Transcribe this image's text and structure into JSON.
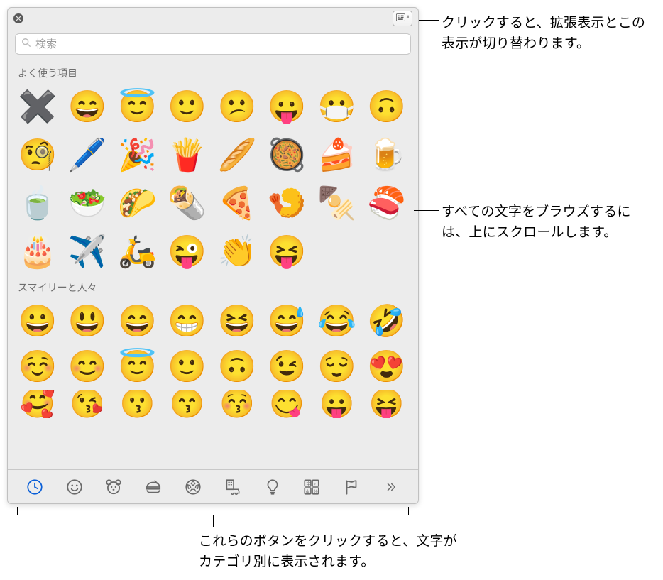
{
  "search": {
    "placeholder": "検索"
  },
  "sections": {
    "frequent": {
      "title": "よく使う項目"
    },
    "smileys": {
      "title": "スマイリーと人々"
    }
  },
  "emojis": {
    "frequent": [
      "✖️",
      "😄",
      "😇",
      "🙂",
      "😕",
      "😛",
      "😷",
      "🙃",
      "🧐",
      "🖊️",
      "🎉",
      "🍟",
      "🥖",
      "🥘",
      "🍰",
      "🍺",
      "🍵",
      "🥗",
      "🌮",
      "🌯",
      "🍕",
      "🍤",
      "🍢",
      "🍣",
      "🎂",
      "✈️",
      "🛵",
      "😜",
      "👏",
      "😝"
    ],
    "smileys_row1": [
      "😀",
      "😃",
      "😄",
      "😁",
      "😆",
      "😅",
      "😂",
      "🤣"
    ],
    "smileys_row2": [
      "☺️",
      "😊",
      "😇",
      "🙂",
      "🙃",
      "😉",
      "😌",
      "😍"
    ],
    "smileys_row3": [
      "🥰",
      "😘",
      "😗",
      "😙",
      "😚",
      "😋",
      "😛",
      "😝"
    ]
  },
  "categories": [
    {
      "id": "recent",
      "name": "最近使った項目"
    },
    {
      "id": "smileys",
      "name": "スマイリーと人々"
    },
    {
      "id": "animals",
      "name": "動物と自然"
    },
    {
      "id": "food",
      "name": "フードとドリンク"
    },
    {
      "id": "activity",
      "name": "アクティビティ"
    },
    {
      "id": "travel",
      "name": "旅行と場所"
    },
    {
      "id": "objects",
      "name": "オブジェクト"
    },
    {
      "id": "symbols",
      "name": "記号"
    },
    {
      "id": "flags",
      "name": "旗"
    },
    {
      "id": "more",
      "name": "その他"
    }
  ],
  "callouts": {
    "top": "クリックすると、拡張表示とこの表示が切り替わります。",
    "middle": "すべての文字をブラウズするには、上にスクロールします。",
    "bottom": "これらのボタンをクリックすると、文字がカテゴリ別に表示されます。"
  }
}
